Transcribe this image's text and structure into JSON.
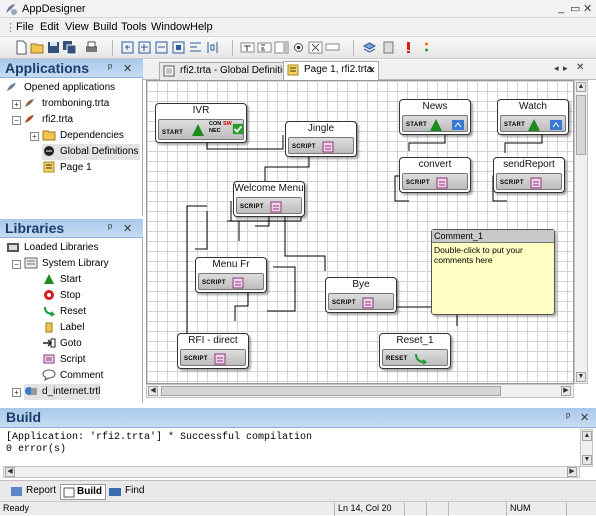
{
  "window": {
    "title": "AppDesigner"
  },
  "menu": [
    {
      "label": "File",
      "u": "F"
    },
    {
      "label": "Edit",
      "u": "E"
    },
    {
      "label": "View",
      "u": "V"
    },
    {
      "label": "Build",
      "u": "B"
    },
    {
      "label": "Tools",
      "u": "T"
    },
    {
      "label": "Window",
      "u": "W"
    },
    {
      "label": "Help",
      "u": "H"
    }
  ],
  "applications_panel": {
    "title": "Applications",
    "root": "Opened applications",
    "items": [
      "tromboning.trta",
      "rfi2.trta",
      "Dependencies",
      "Global Definitions",
      "Page 1"
    ]
  },
  "libraries_panel": {
    "title": "Libraries",
    "root": "Loaded Libraries",
    "system_library": "System Library",
    "items": [
      "Start",
      "Stop",
      "Reset",
      "Label",
      "Goto",
      "Script",
      "Comment"
    ],
    "extra": "d_internet.trtl"
  },
  "tabs": [
    {
      "label": "rfi2.trta - Global Definitions"
    },
    {
      "label": "Page 1, rfi2.trta"
    }
  ],
  "nodes": {
    "ivr": {
      "title": "IVR",
      "type": "START",
      "extra1": "CON",
      "extra2": "NEC",
      "extra3": "SW"
    },
    "jingle": {
      "title": "Jingle",
      "type": "SCRIPT"
    },
    "news": {
      "title": "News",
      "type": "START"
    },
    "watch": {
      "title": "Watch",
      "type": "START"
    },
    "convert": {
      "title": "convert",
      "type": "SCRIPT"
    },
    "sendreport": {
      "title": "sendReport",
      "type": "SCRIPT"
    },
    "welcome": {
      "title": "Welcome Menu",
      "type": "SCRIPT"
    },
    "menufr": {
      "title": "Menu Fr",
      "type": "SCRIPT"
    },
    "bye": {
      "title": "Bye",
      "type": "SCRIPT"
    },
    "rfidirect": {
      "title": "RFI - direct",
      "type": "SCRIPT"
    },
    "reset": {
      "title": "Reset_1",
      "type": "RESET"
    }
  },
  "comment": {
    "title": "Comment_1",
    "body": "Double-click to put your comments here"
  },
  "build": {
    "title": "Build",
    "lines": [
      "[Application: 'rfi2.trta'] * Successful compilation",
      "0 error(s)"
    ]
  },
  "bottom_tabs": [
    "Report",
    "Build",
    "Find"
  ],
  "status": {
    "left": "Ready",
    "pos": "Ln 14, Col 20",
    "num": "NUM"
  }
}
